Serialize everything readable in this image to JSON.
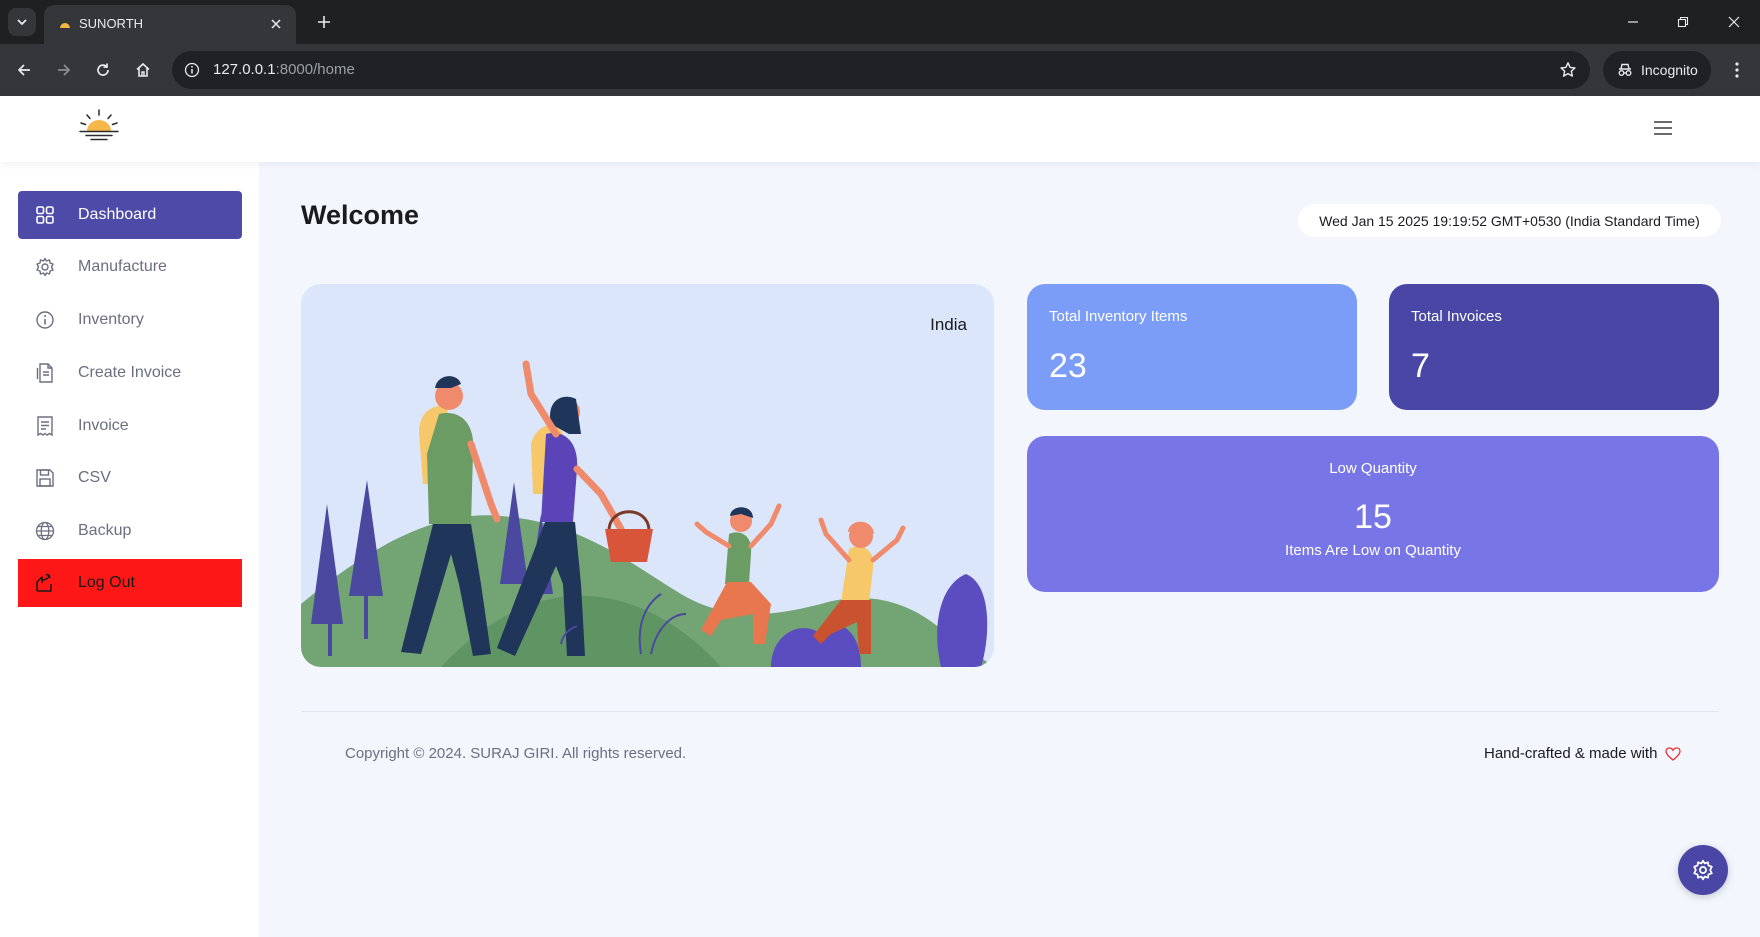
{
  "browser": {
    "tab_title": "SUNORTH",
    "url_host": "127.0.0.1",
    "url_rest": ":8000/home",
    "incognito_label": "Incognito"
  },
  "sidebar": {
    "items": [
      {
        "label": "Dashboard",
        "icon": "grid-icon",
        "active": true
      },
      {
        "label": "Manufacture",
        "icon": "gear-icon"
      },
      {
        "label": "Inventory",
        "icon": "info-icon"
      },
      {
        "label": "Create Invoice",
        "icon": "document-icon"
      },
      {
        "label": "Invoice",
        "icon": "receipt-icon"
      },
      {
        "label": "CSV",
        "icon": "floppy-icon"
      },
      {
        "label": "Backup",
        "icon": "globe-icon"
      },
      {
        "label": "Log Out",
        "icon": "logout-icon",
        "danger": true
      }
    ]
  },
  "main": {
    "title": "Welcome",
    "datetime": "Wed Jan 15 2025 19:19:52 GMT+0530 (India Standard Time)",
    "hero": {
      "country": "India"
    },
    "cards": {
      "inventory": {
        "label": "Total Inventory Items",
        "value": "23"
      },
      "invoices": {
        "label": "Total Invoices",
        "value": "7"
      },
      "low": {
        "label": "Low Quantity",
        "value": "15",
        "caption": "Items Are Low on Quantity"
      }
    }
  },
  "footer": {
    "copyright": "Copyright © 2024. SURAJ GIRI. All rights reserved.",
    "handcrafted": "Hand-crafted & made with"
  },
  "colors": {
    "accent": "#4e4aa8",
    "danger": "#fe1717",
    "card_blue": "#7b9cf7",
    "card_indigo": "#4a46a5",
    "card_violet": "#7876e6"
  }
}
